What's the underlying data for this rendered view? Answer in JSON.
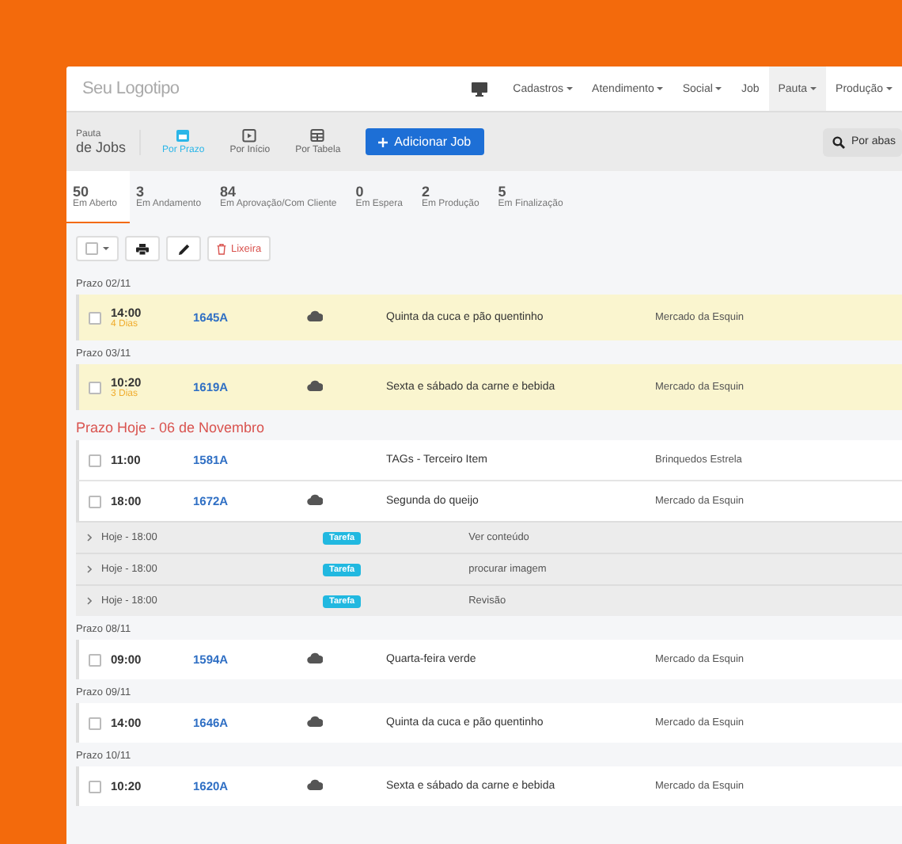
{
  "navbar": {
    "logo": "Seu Logotipo",
    "items": [
      {
        "label": "Cadastros",
        "dropdown": true,
        "selected": false
      },
      {
        "label": "Atendimento",
        "dropdown": true,
        "selected": false
      },
      {
        "label": "Social",
        "dropdown": true,
        "selected": false
      },
      {
        "label": "Job",
        "dropdown": false,
        "selected": false
      },
      {
        "label": "Pauta",
        "dropdown": true,
        "selected": true
      },
      {
        "label": "Produção",
        "dropdown": true,
        "selected": false
      }
    ]
  },
  "toolbar": {
    "title_small": "Pauta",
    "title": "de Jobs",
    "views": [
      {
        "label": "Por Prazo",
        "kind": "calendar",
        "selected": true
      },
      {
        "label": "Por Início",
        "kind": "play",
        "selected": false
      },
      {
        "label": "Por Tabela",
        "kind": "table",
        "selected": false
      }
    ],
    "add_button": "Adicionar Job",
    "search": {
      "placeholder": "Por abas"
    }
  },
  "stats": [
    {
      "count": "50",
      "label": "Em Aberto",
      "selected": true
    },
    {
      "count": "3",
      "label": "Em Andamento",
      "selected": false
    },
    {
      "count": "84",
      "label": "Em Aprovação/Com Cliente",
      "selected": false
    },
    {
      "count": "0",
      "label": "Em Espera",
      "selected": false
    },
    {
      "count": "2",
      "label": "Em Produção",
      "selected": false
    },
    {
      "count": "5",
      "label": "Em Finalização",
      "selected": false
    }
  ],
  "actions": {
    "trash_button": "Lixeira"
  },
  "groups": [
    {
      "title": "Prazo 02/11",
      "today": false,
      "items": [
        {
          "kind": "job",
          "late": true,
          "time": "14:00",
          "days": "4 Dias",
          "id": "1645A",
          "cloud": true,
          "title": "Quinta da cuca e pão quentinho",
          "client": "Mercado da Esquin"
        }
      ]
    },
    {
      "title": "Prazo 03/11",
      "today": false,
      "items": [
        {
          "kind": "job",
          "late": true,
          "time": "10:20",
          "days": "3 Dias",
          "id": "1619A",
          "cloud": true,
          "title": "Sexta e sábado da carne e bebida",
          "client": "Mercado da Esquin"
        }
      ]
    },
    {
      "title": "Prazo Hoje - 06 de Novembro",
      "today": true,
      "items": [
        {
          "kind": "job",
          "late": false,
          "time": "11:00",
          "id": "1581A",
          "cloud": false,
          "title": "TAGs - Terceiro Item",
          "client": "Brinquedos Estrela"
        },
        {
          "kind": "job",
          "late": false,
          "time": "18:00",
          "id": "1672A",
          "cloud": true,
          "title": "Segunda do queijo",
          "client": "Mercado da Esquin"
        },
        {
          "kind": "task",
          "when": "Hoje - 18:00",
          "badge": "Tarefa",
          "title": "Ver conteúdo"
        },
        {
          "kind": "task",
          "when": "Hoje - 18:00",
          "badge": "Tarefa",
          "title": "procurar imagem"
        },
        {
          "kind": "task",
          "when": "Hoje - 18:00",
          "badge": "Tarefa",
          "title": "Revisão"
        }
      ]
    },
    {
      "title": "Prazo 08/11",
      "today": false,
      "items": [
        {
          "kind": "job",
          "late": false,
          "time": "09:00",
          "id": "1594A",
          "cloud": true,
          "title": "Quarta-feira verde",
          "client": "Mercado da Esquin"
        }
      ]
    },
    {
      "title": "Prazo 09/11",
      "today": false,
      "items": [
        {
          "kind": "job",
          "late": false,
          "time": "14:00",
          "id": "1646A",
          "cloud": true,
          "title": "Quinta da cuca e pão quentinho",
          "client": "Mercado da Esquin"
        }
      ]
    },
    {
      "title": "Prazo 10/11",
      "today": false,
      "items": [
        {
          "kind": "job",
          "late": false,
          "time": "10:20",
          "id": "1620A",
          "cloud": true,
          "title": "Sexta e sábado da carne e bebida",
          "client": "Mercado da Esquin"
        }
      ]
    }
  ]
}
